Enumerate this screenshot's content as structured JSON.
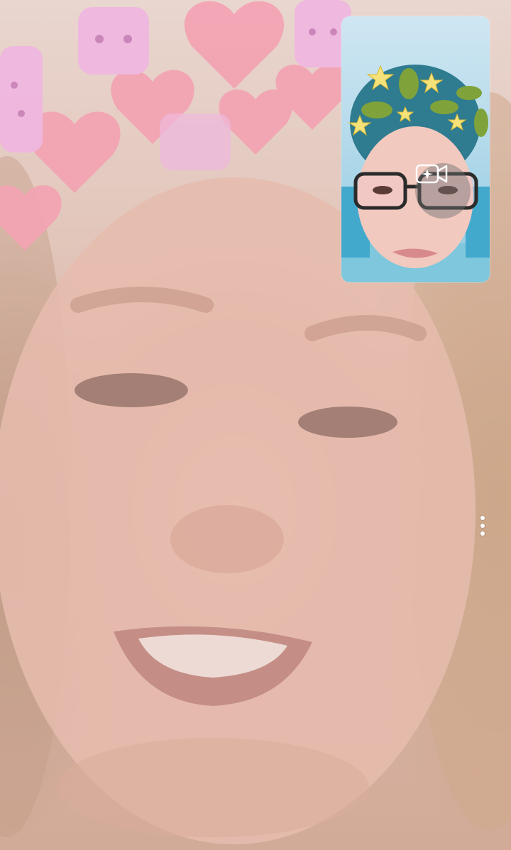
{
  "remote_video": {
    "filter": "pink-hearts-crown",
    "colors": {
      "skin": "#e4b9ab",
      "hair": "#c9a487",
      "heart": "#f4a3b3",
      "bunny": "#f0b6e0"
    }
  },
  "self_view": {
    "filter": "dinosaur-stars-crown",
    "colors": {
      "background": "#b8dcec",
      "hair": "#2f7b8f",
      "dino": "#7fa33a",
      "star": "#f5e27a"
    },
    "effects_button": {
      "icon": "video-sparkle-icon"
    }
  },
  "controls": {
    "more_options": {
      "icon": "more-vertical-icon"
    }
  }
}
